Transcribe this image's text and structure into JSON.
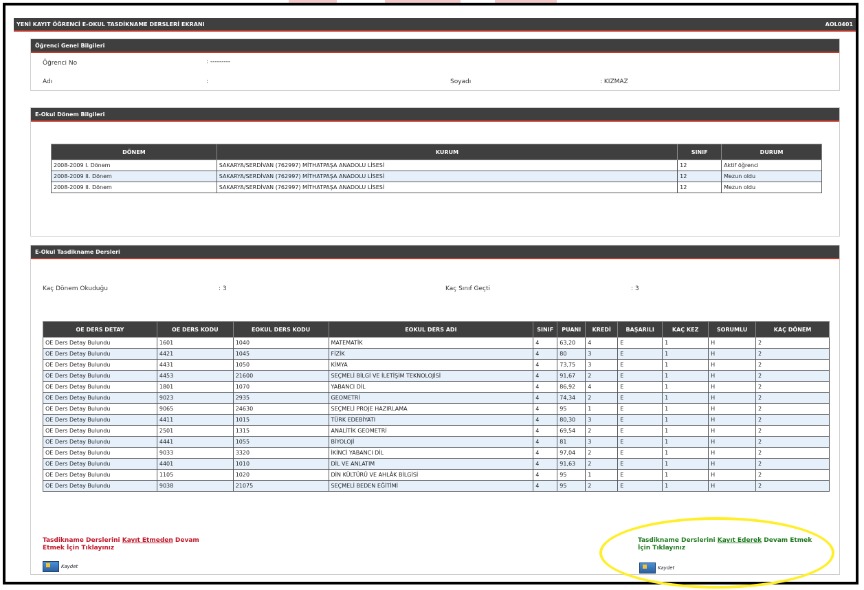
{
  "window": {
    "title": "YENİ KAYIT ÖĞRENCİ E-OKUL TASDİKNAME DERSLERİ EKRANI",
    "code": "AOL0401"
  },
  "student": {
    "header": "Öğrenci Genel Bilgileri",
    "no_label": "Öğrenci No",
    "no_value": ": ---------",
    "name_label": "Adı",
    "name_value": ":",
    "surname_label": "Soyadı",
    "surname_value": ": KIZMAZ"
  },
  "term": {
    "header": "E-Okul Dönem Bilgileri",
    "columns": [
      "DÖNEM",
      "KURUM",
      "SINIF",
      "DURUM"
    ],
    "rows": [
      [
        "2008-2009 I. Dönem",
        "SAKARYA/SERDİVAN (762997) MİTHATPAŞA ANADOLU LİSESİ",
        "12",
        "Aktif öğrenci"
      ],
      [
        "2008-2009 II. Dönem",
        "SAKARYA/SERDİVAN (762997) MİTHATPAŞA ANADOLU LİSESİ",
        "12",
        "Mezun oldu"
      ],
      [
        "2008-2009 II. Dönem",
        "SAKARYA/SERDİVAN (762997) MİTHATPAŞA ANADOLU LİSESİ",
        "12",
        "Mezun oldu"
      ]
    ]
  },
  "courses": {
    "header": "E-Okul Tasdikname Dersleri",
    "terms_label": "Kaç Dönem Okuduğu",
    "terms_value": ": 3",
    "passed_label": "Kaç Sınıf Geçti",
    "passed_value": ": 3",
    "columns": [
      "OE DERS DETAY",
      "OE DERS KODU",
      "EOKUL DERS KODU",
      "EOKUL DERS ADI",
      "SINIF",
      "PUANI",
      "KREDİ",
      "BAŞARILI",
      "KAÇ KEZ",
      "SORUMLU",
      "KAÇ DÖNEM"
    ],
    "rows": [
      [
        "OE Ders Detay Bulundu",
        "1601",
        "1040",
        "MATEMATİK",
        "4",
        "63,20",
        "4",
        "E",
        "1",
        "H",
        "2"
      ],
      [
        "OE Ders Detay Bulundu",
        "4421",
        "1045",
        "FİZİK",
        "4",
        "80",
        "3",
        "E",
        "1",
        "H",
        "2"
      ],
      [
        "OE Ders Detay Bulundu",
        "4431",
        "1050",
        "KİMYA",
        "4",
        "73,75",
        "3",
        "E",
        "1",
        "H",
        "2"
      ],
      [
        "OE Ders Detay Bulundu",
        "4453",
        "21600",
        "SEÇMELİ BİLGİ VE İLETİŞİM TEKNOLOJİSİ",
        "4",
        "91,67",
        "2",
        "E",
        "1",
        "H",
        "2"
      ],
      [
        "OE Ders Detay Bulundu",
        "1801",
        "1070",
        "YABANCI DİL",
        "4",
        "86,92",
        "4",
        "E",
        "1",
        "H",
        "2"
      ],
      [
        "OE Ders Detay Bulundu",
        "9023",
        "2935",
        "GEOMETRİ",
        "4",
        "74,34",
        "2",
        "E",
        "1",
        "H",
        "2"
      ],
      [
        "OE Ders Detay Bulundu",
        "9065",
        "24630",
        "SEÇMELİ PROJE HAZIRLAMA",
        "4",
        "95",
        "1",
        "E",
        "1",
        "H",
        "2"
      ],
      [
        "OE Ders Detay Bulundu",
        "4411",
        "1015",
        "TÜRK EDEBİYATI",
        "4",
        "80,30",
        "3",
        "E",
        "1",
        "H",
        "2"
      ],
      [
        "OE Ders Detay Bulundu",
        "2501",
        "1315",
        "ANALİTİK GEOMETRİ",
        "4",
        "69,54",
        "2",
        "E",
        "1",
        "H",
        "2"
      ],
      [
        "OE Ders Detay Bulundu",
        "4441",
        "1055",
        "BİYOLOJİ",
        "4",
        "81",
        "3",
        "E",
        "1",
        "H",
        "2"
      ],
      [
        "OE Ders Detay Bulundu",
        "9033",
        "3320",
        "İKİNCİ YABANCI DİL",
        "4",
        "97,04",
        "2",
        "E",
        "1",
        "H",
        "2"
      ],
      [
        "OE Ders Detay Bulundu",
        "4401",
        "1010",
        "DİL VE ANLATIM",
        "4",
        "91,63",
        "2",
        "E",
        "1",
        "H",
        "2"
      ],
      [
        "OE Ders Detay Bulundu",
        "1105",
        "1020",
        "DİN KÜLTÜRÜ VE AHLÂK BİLGİSİ",
        "4",
        "95",
        "1",
        "E",
        "1",
        "H",
        "2"
      ],
      [
        "OE Ders Detay Bulundu",
        "9038",
        "21075",
        "SEÇMELİ BEDEN EĞİTİMİ",
        "4",
        "95",
        "2",
        "E",
        "1",
        "H",
        "2"
      ]
    ]
  },
  "actions": {
    "no_save_prefix": "Tasdikname Derslerini ",
    "no_save_link": "Kayıt Etmeden",
    "no_save_suffix": " Devam Etmek İçin Tıklayınız",
    "save_prefix": "Tasdikname Derslerini ",
    "save_link": "Kayıt Ederek",
    "save_suffix": " Devam Etmek İçin Tıklayınız",
    "button_label": "Kaydet"
  },
  "colors": {
    "header_bg": "#3f3f3f",
    "accent": "#c0392b",
    "red_link": "#c0182a",
    "green_link": "#1f7a1f",
    "highlight": "#ffef2a"
  }
}
